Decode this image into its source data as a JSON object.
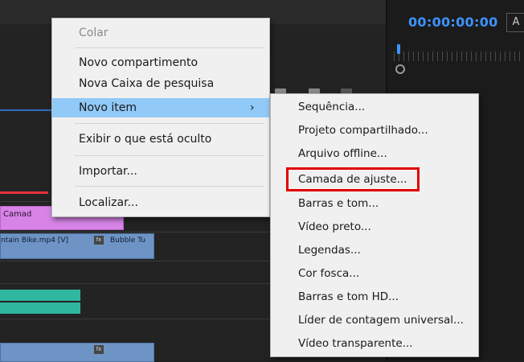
{
  "monitor": {
    "timecode": "00:00:00:00",
    "button_label": "A"
  },
  "timeline": {
    "clips": {
      "pink_label": "Camad",
      "blue_label_1": "ntain Bike.mp4 [V]",
      "blue_label_2": "Bubble Tu",
      "fx_badge": "fx"
    }
  },
  "context_menu": {
    "items": [
      {
        "label": "Colar",
        "disabled": true
      },
      {
        "label": "Novo compartimento"
      },
      {
        "label": "Nova Caixa de pesquisa"
      },
      {
        "label": "Novo item",
        "submenu_arrow": "›",
        "highlighted": true
      },
      {
        "label": "Exibir o que está oculto"
      },
      {
        "label": "Importar..."
      },
      {
        "label": "Localizar..."
      }
    ]
  },
  "submenu": {
    "items": [
      {
        "label": "Sequência..."
      },
      {
        "label": "Projeto compartilhado..."
      },
      {
        "label": "Arquivo offline..."
      },
      {
        "label": "Camada de ajuste...",
        "annotated": true
      },
      {
        "label": "Barras e tom..."
      },
      {
        "label": "Vídeo preto..."
      },
      {
        "label": "Legendas..."
      },
      {
        "label": "Cor fosca..."
      },
      {
        "label": "Barras e tom HD..."
      },
      {
        "label": "Líder de contagem universal..."
      },
      {
        "label": "Vídeo transparente..."
      }
    ]
  },
  "colors": {
    "accent_blue": "#3d93ff",
    "highlight_red": "#e00000",
    "menu_hover": "#91c9f7"
  }
}
